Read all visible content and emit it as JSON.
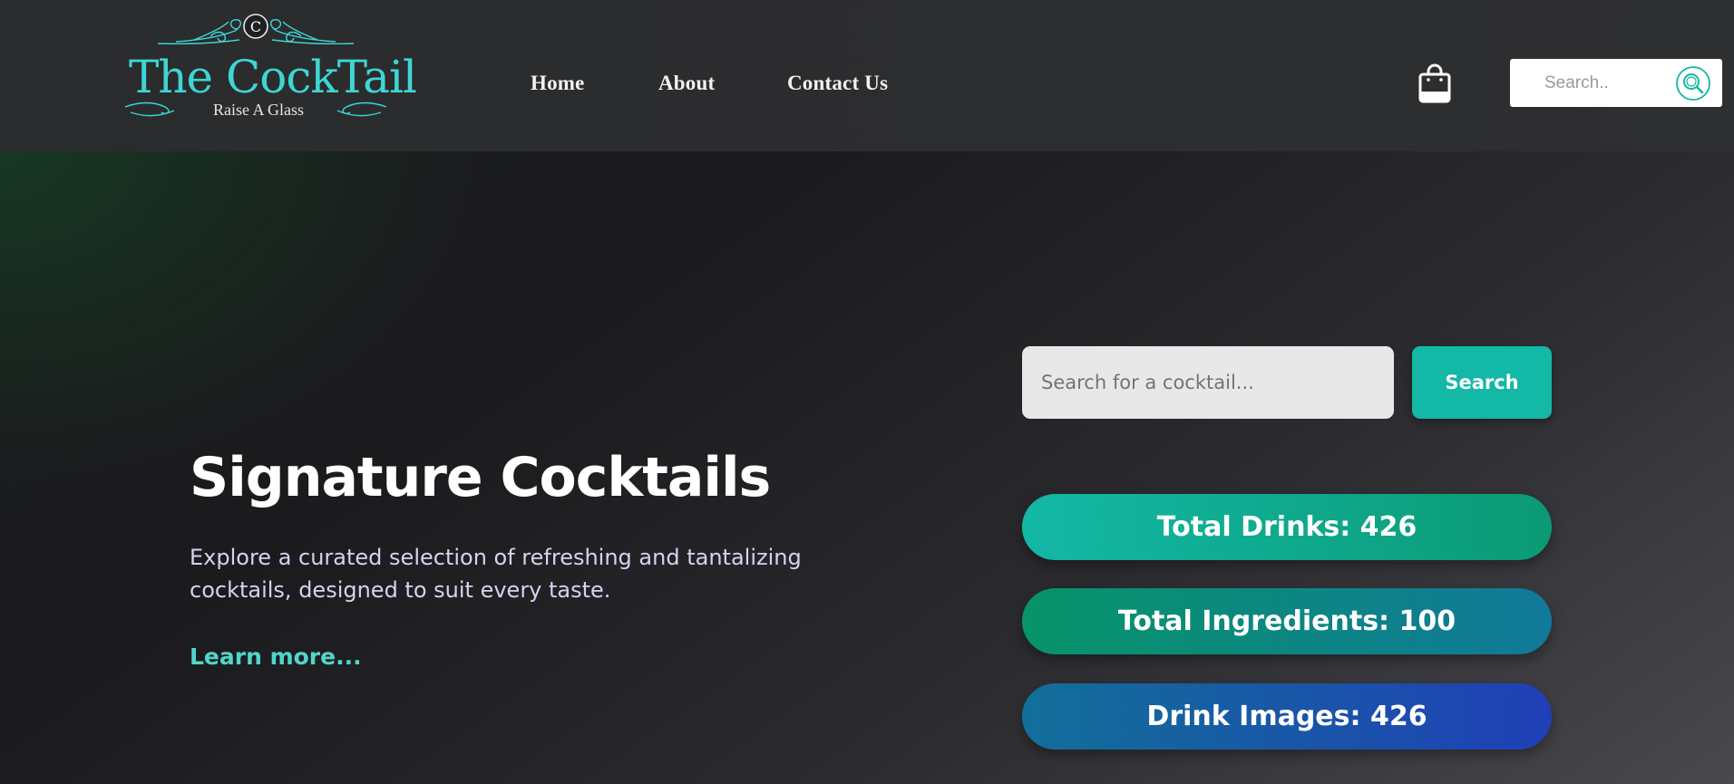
{
  "header": {
    "logo": {
      "title": "The CockTail",
      "tagline": "Raise A Glass",
      "monogram": "C"
    },
    "nav": [
      {
        "label": "Home"
      },
      {
        "label": "About"
      },
      {
        "label": "Contact Us"
      }
    ],
    "cart_icon": "shopping-bag-icon",
    "search": {
      "placeholder": "Search..",
      "icon": "search-icon"
    }
  },
  "hero": {
    "title": "Signature Cocktails",
    "description": "Explore a curated selection of refreshing and tantalizing cocktails, designed to suit every taste.",
    "link": "Learn more...",
    "search": {
      "placeholder": "Search for a cocktail...",
      "button": "Search"
    },
    "stats": [
      {
        "label": "Total Drinks: 426"
      },
      {
        "label": "Total Ingredients: 100"
      },
      {
        "label": "Drink Images: 426"
      }
    ]
  },
  "colors": {
    "accent_teal": "#13b8a6",
    "logo_cyan": "#3ed6d3",
    "link_teal": "#4fd7c9",
    "header_bg": "#2c2d2f",
    "stat_green": "#079468",
    "stat_blue": "#1f3fb6"
  }
}
